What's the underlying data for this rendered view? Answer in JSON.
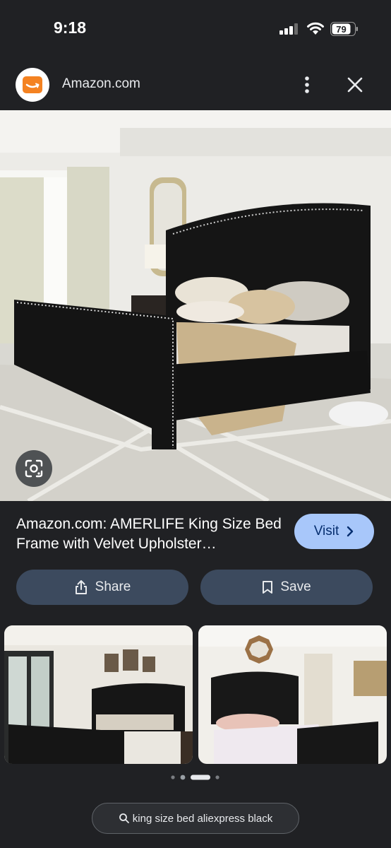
{
  "status": {
    "time": "9:18",
    "battery": "79"
  },
  "header": {
    "site_name": "Amazon.com"
  },
  "result": {
    "title": "Amazon.com: AMERLIFE King Size Bed Frame with Velvet Upholster…",
    "visit_label": "Visit"
  },
  "actions": {
    "share_label": "Share",
    "save_label": "Save"
  },
  "search_chip": {
    "query": "king size bed aliexpress black"
  },
  "pager": {
    "count": 4,
    "active_index": 2
  },
  "icons": {
    "logo": "amazon-smile-icon",
    "menu": "more-vert-icon",
    "close": "close-icon",
    "lens": "google-lens-icon",
    "visit": "chevron-right-icon",
    "share": "share-icon",
    "save": "bookmark-icon",
    "search": "search-icon"
  },
  "colors": {
    "background": "#202124",
    "accent": "#a8c7fa",
    "button_fill": "#3c4a5e",
    "logo": "#f48221"
  }
}
